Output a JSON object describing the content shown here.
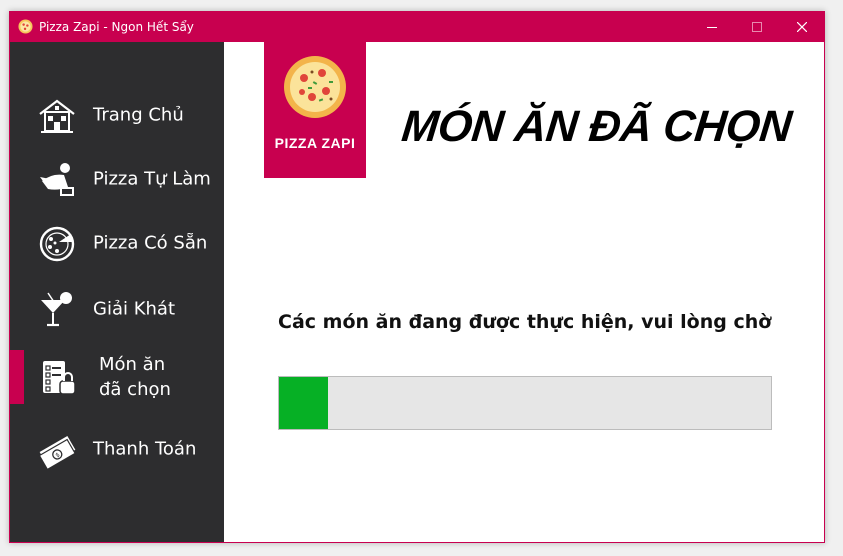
{
  "window": {
    "title": "Pizza Zapi - Ngon Hết Sẩy",
    "accent_color": "#c8004f",
    "sidebar_color": "#2d2d2f"
  },
  "sidebar": {
    "items": [
      {
        "label": "Trang Chủ",
        "icon": "house-icon"
      },
      {
        "label": "Pizza Tự Làm",
        "icon": "chef-icon"
      },
      {
        "label": "Pizza Có Sẵn",
        "icon": "pizza-icon"
      },
      {
        "label": "Giải Khát",
        "icon": "cocktail-icon"
      },
      {
        "label_line1": "Món ăn",
        "label_line2": "đã chọn",
        "icon": "order-list-icon",
        "active": true
      },
      {
        "label": "Thanh Toán",
        "icon": "money-icon"
      }
    ]
  },
  "logo": {
    "text": "PIZZA ZAPI"
  },
  "main": {
    "title": "MÓN ĂN ĐÃ CHỌN",
    "status": "Các món ăn đang được thực hiện, vui lòng chờ",
    "progress_fraction": 0.1,
    "progress_color": "#06b025"
  }
}
